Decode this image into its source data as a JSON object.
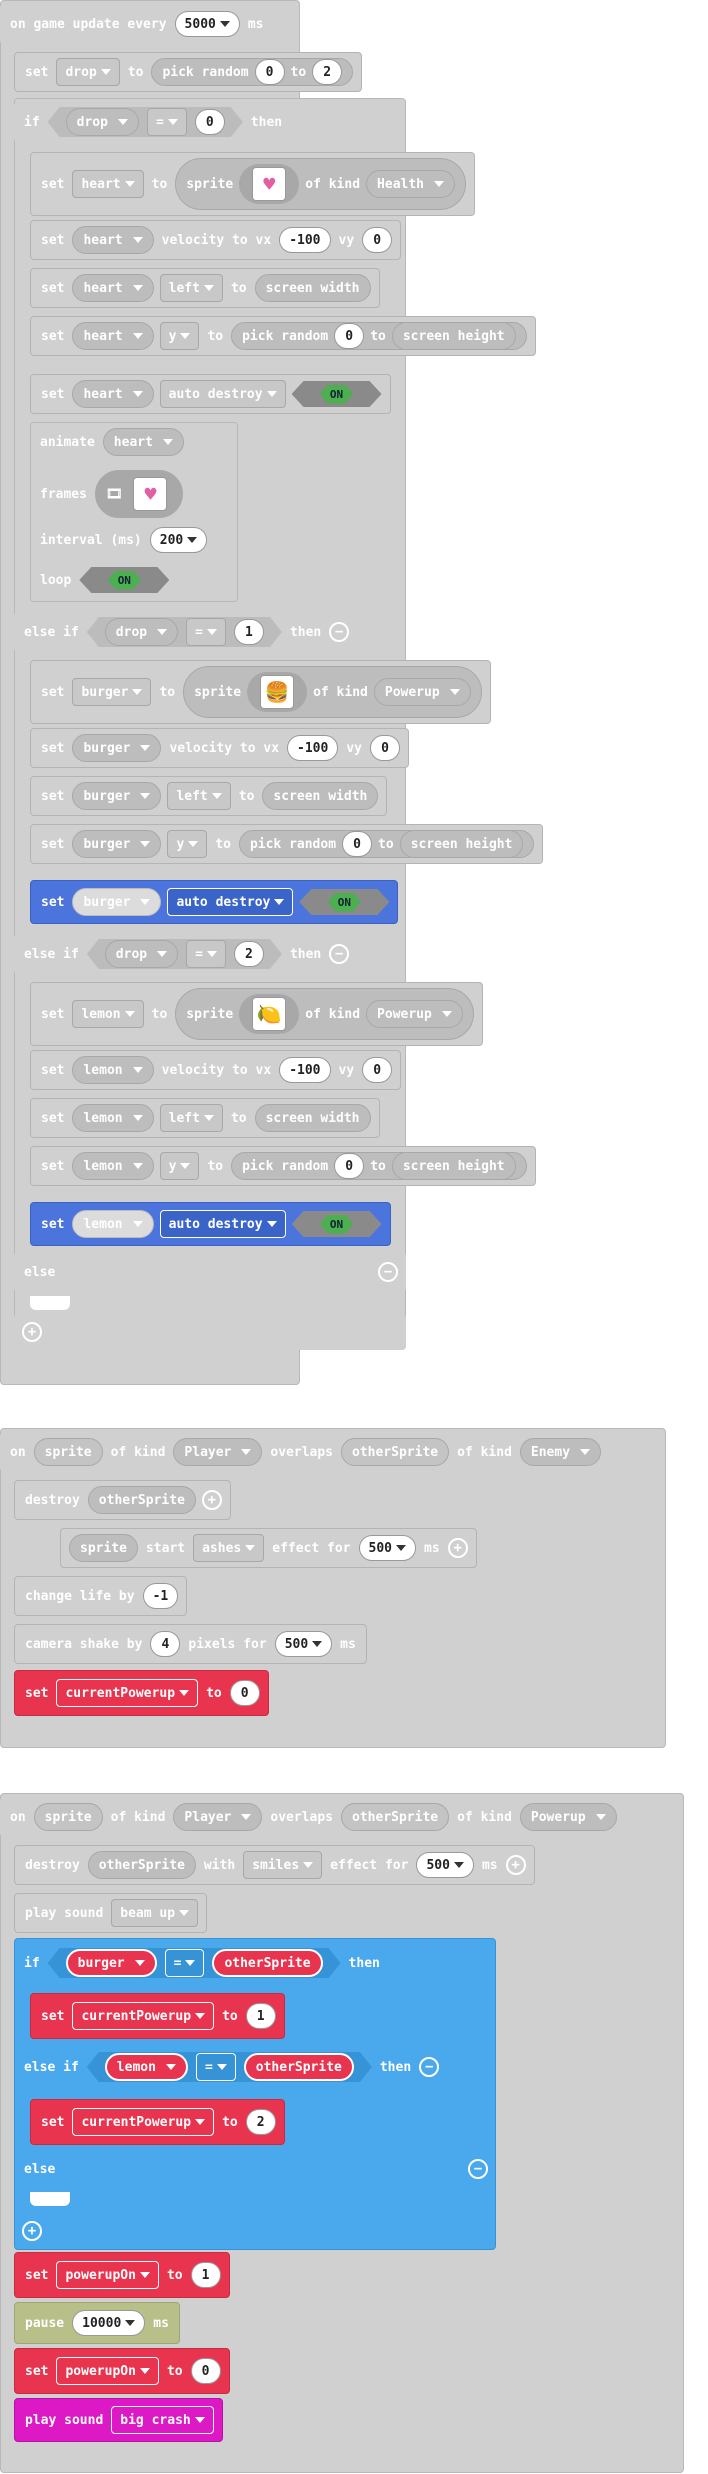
{
  "s1": {
    "on_game_update": "on game update every",
    "interval_ms": "5000",
    "ms": "ms",
    "set": "set",
    "to": "to",
    "pick_random": "pick random",
    "if": "if",
    "then": "then",
    "else_if": "else if",
    "else": "else",
    "drop": "drop",
    "zero": "0",
    "one": "1",
    "two": "2",
    "eq": "=",
    "sprite": "sprite",
    "of_kind": "of kind",
    "health": "Health",
    "powerup": "Powerup",
    "heart": "heart",
    "burger": "burger",
    "lemon": "lemon",
    "velocity": "velocity to vx",
    "vy": "vy",
    "vx_val": "-100",
    "vy_val": "0",
    "left": "left",
    "screen_width": "screen width",
    "y": "y",
    "screen_height": "screen height",
    "auto_destroy": "auto destroy",
    "on": "ON",
    "animate": "animate",
    "frames": "frames",
    "interval": "interval (ms)",
    "interval_val": "200",
    "loop": "loop"
  },
  "s2": {
    "on": "on",
    "sprite": "sprite",
    "of_kind": "of kind",
    "player": "Player",
    "overlaps": "overlaps",
    "other": "otherSprite",
    "enemy": "Enemy",
    "destroy": "destroy",
    "start": "start",
    "ashes": "ashes",
    "effect_for": "effect for",
    "ms_val": "500",
    "ms": "ms",
    "change_life": "change life by",
    "life_val": "-1",
    "camera_shake": "camera shake by",
    "shake_val": "4",
    "pixels_for": "pixels for",
    "set": "set",
    "current_powerup": "currentPowerup",
    "to": "to",
    "zero": "0"
  },
  "s3": {
    "on": "on",
    "sprite": "sprite",
    "of_kind": "of kind",
    "player": "Player",
    "overlaps": "overlaps",
    "other": "otherSprite",
    "powerup": "Powerup",
    "destroy": "destroy",
    "with": "with",
    "smiles": "smiles",
    "effect_for": "effect for",
    "ms_val": "500",
    "ms": "ms",
    "play_sound": "play sound",
    "beam_up": "beam up",
    "if": "if",
    "burger": "burger",
    "eq": "=",
    "then": "then",
    "else_if": "else if",
    "lemon": "lemon",
    "else": "else",
    "set": "set",
    "current_powerup": "currentPowerup",
    "to": "to",
    "one": "1",
    "two": "2",
    "powerup_on": "powerupOn",
    "pause": "pause",
    "pause_val": "10000",
    "zero": "0",
    "big_crash": "big crash"
  },
  "icons": {
    "plus": "+",
    "minus": "−",
    "heart_sprite": "heart-sprite-icon",
    "burger_sprite": "burger-sprite-icon",
    "lemon_sprite": "lemon-sprite-icon"
  },
  "colors": {
    "grey_block": "#d0d0d0",
    "blue_block": "#4b75dc",
    "light_blue_if": "#4aa8ec",
    "red_set": "#e8344e",
    "olive_pause": "#b8bf89",
    "magenta_sound": "#dd19c6",
    "toggle_on": "#4caf50"
  }
}
